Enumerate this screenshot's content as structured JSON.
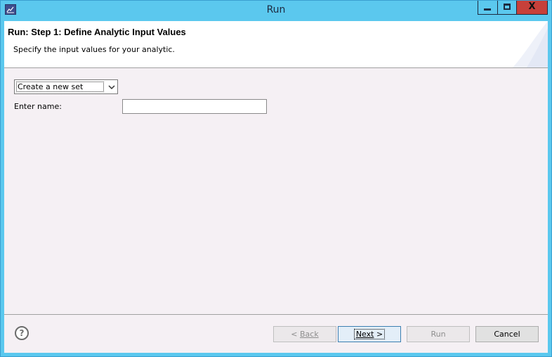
{
  "window": {
    "title": "Run",
    "app_icon": "eclipse-chart-icon",
    "controls": {
      "minimize": "minimize-icon",
      "maximize": "maximize-icon",
      "close": "close-icon",
      "close_glyph": "X"
    }
  },
  "header": {
    "title": "Run: Step 1: Define Analytic Input Values",
    "description": "Specify the input values for your analytic."
  },
  "form": {
    "set_select": {
      "value": "Create a new set",
      "icon": "chevron-down-icon"
    },
    "name_label": "Enter name:",
    "name_value": ""
  },
  "footer": {
    "help_glyph": "?",
    "help_icon": "help-icon",
    "buttons": [
      {
        "label": "Back",
        "prefix": "< ",
        "enabled": false
      },
      {
        "label": "Next",
        "suffix": " >",
        "enabled": true,
        "default": true
      },
      {
        "label": "Run",
        "enabled": false
      },
      {
        "label": "Cancel",
        "enabled": true
      }
    ]
  },
  "colors": {
    "titlebar": "#5bc8ee",
    "close_button": "#c7403a",
    "client_background": "#f5f0f4",
    "header_background": "#ffffff"
  }
}
